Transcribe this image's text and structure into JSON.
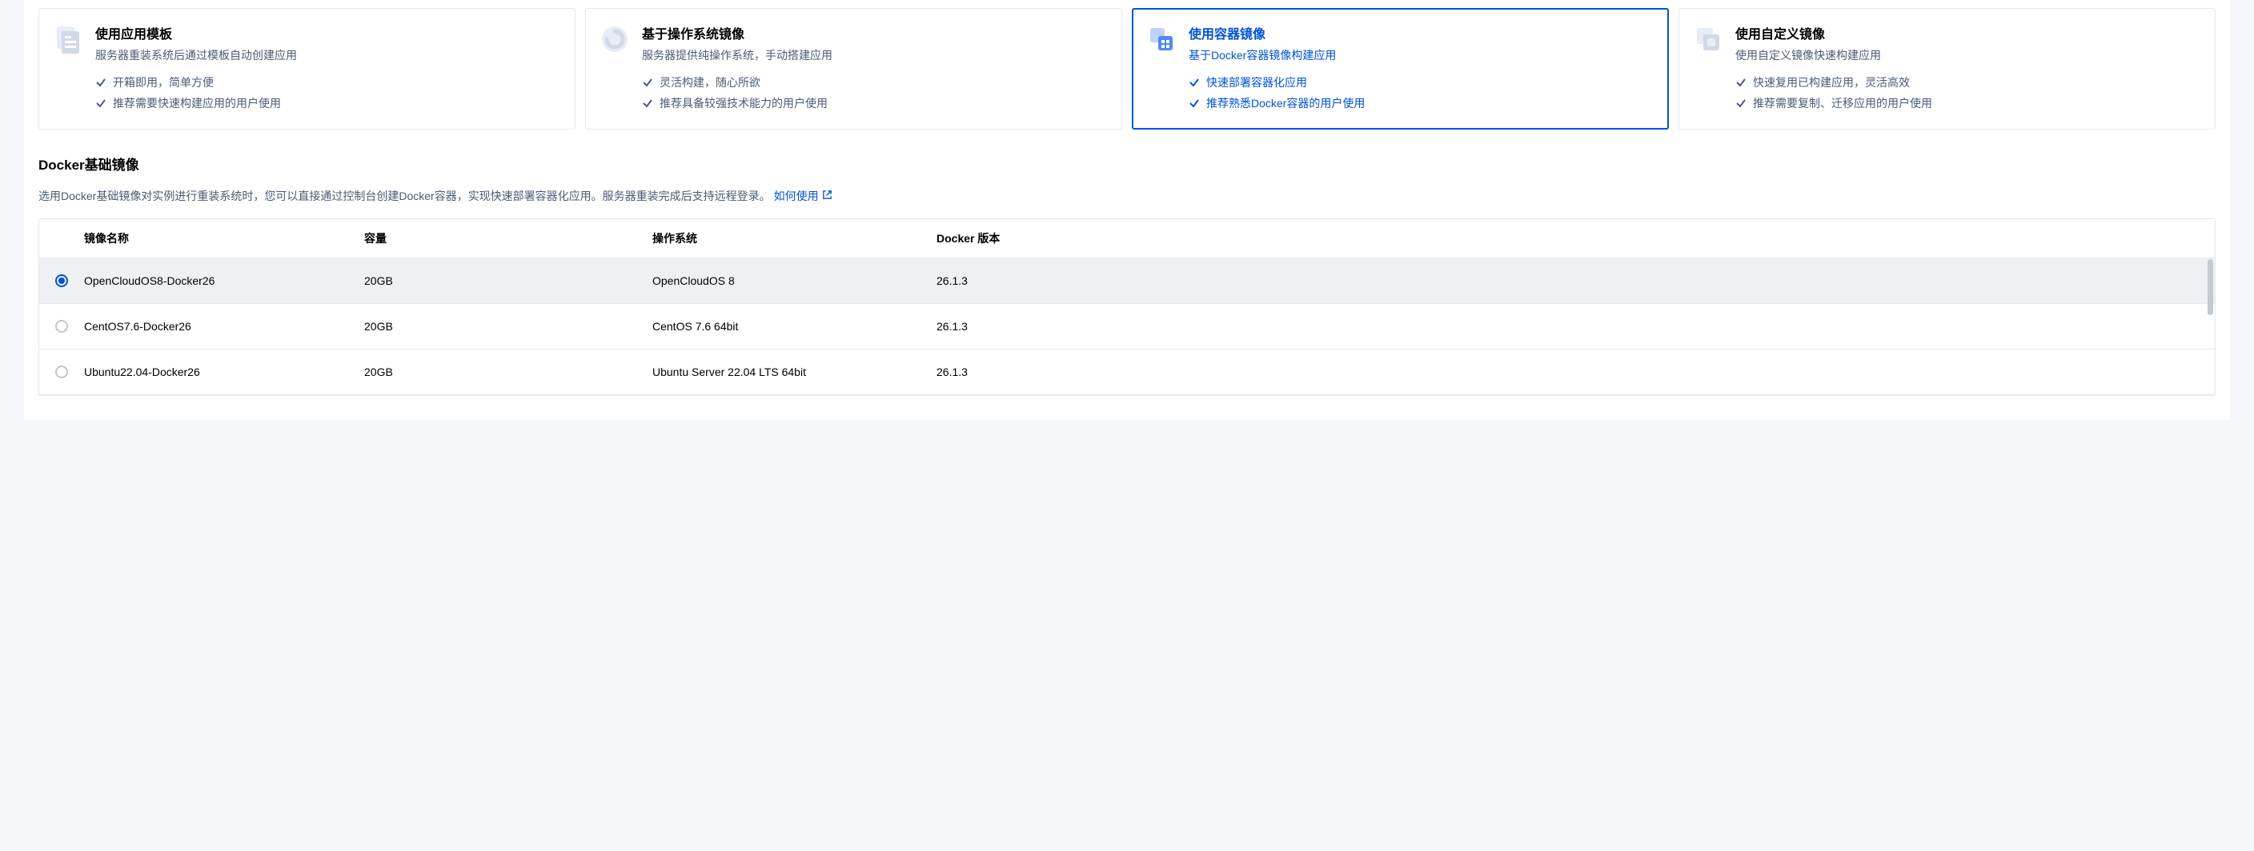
{
  "options": [
    {
      "title": "使用应用模板",
      "sub": "服务器重装系统后通过模板自动创建应用",
      "features": [
        "开箱即用，简单方便",
        "推荐需要快速构建应用的用户使用"
      ]
    },
    {
      "title": "基于操作系统镜像",
      "sub": "服务器提供纯操作系统，手动搭建应用",
      "features": [
        "灵活构建，随心所欲",
        "推荐具备较强技术能力的用户使用"
      ]
    },
    {
      "title": "使用容器镜像",
      "sub": "基于Docker容器镜像构建应用",
      "features": [
        "快速部署容器化应用",
        "推荐熟悉Docker容器的用户使用"
      ]
    },
    {
      "title": "使用自定义镜像",
      "sub": "使用自定义镜像快速构建应用",
      "features": [
        "快速复用已构建应用，灵活高效",
        "推荐需要复制、迁移应用的用户使用"
      ]
    }
  ],
  "section": {
    "title": "Docker基础镜像",
    "desc_prefix": "选用Docker基础镜像对实例进行重装系统时，您可以直接通过控制台创建Docker容器，实现快速部署容器化应用。服务器重装完成后支持远程登录。",
    "link_text": "如何使用"
  },
  "table": {
    "headers": [
      "镜像名称",
      "容量",
      "操作系统",
      "Docker 版本"
    ],
    "rows": [
      {
        "name": "OpenCloudOS8-Docker26",
        "capacity": "20GB",
        "os": "OpenCloudOS 8",
        "version": "26.1.3",
        "selected": true
      },
      {
        "name": "CentOS7.6-Docker26",
        "capacity": "20GB",
        "os": "CentOS 7.6 64bit",
        "version": "26.1.3",
        "selected": false
      },
      {
        "name": "Ubuntu22.04-Docker26",
        "capacity": "20GB",
        "os": "Ubuntu Server 22.04 LTS 64bit",
        "version": "26.1.3",
        "selected": false
      }
    ]
  }
}
